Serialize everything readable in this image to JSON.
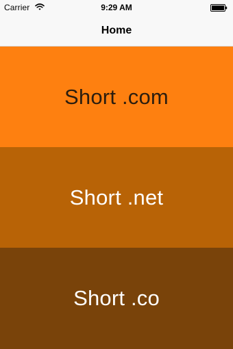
{
  "status_bar": {
    "carrier": "Carrier",
    "time": "9:29 AM",
    "wifi_icon": "wifi-icon",
    "battery_icon": "battery-icon"
  },
  "nav": {
    "title": "Home"
  },
  "tiles": [
    {
      "label": "Short .com",
      "color": "#fe8010",
      "text_color": "#2b1d0f"
    },
    {
      "label": "Short .net",
      "color": "#b86306",
      "text_color": "#ffffff"
    },
    {
      "label": "Short .co",
      "color": "#79430a",
      "text_color": "#ffffff"
    }
  ]
}
